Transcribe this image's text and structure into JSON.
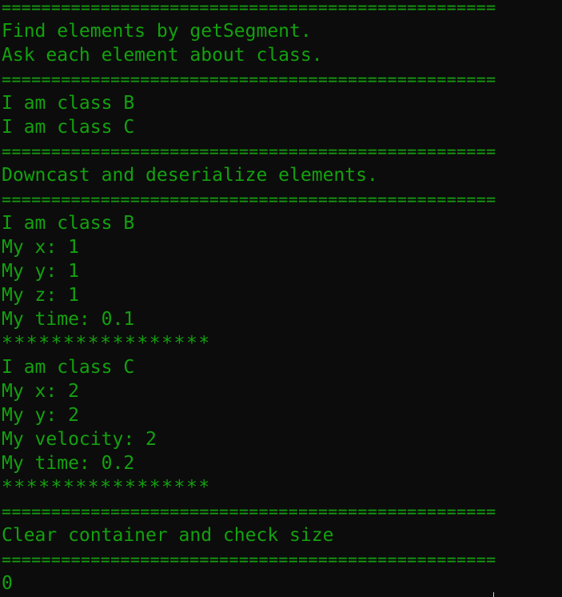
{
  "terminal": {
    "lines": [
      "==================================================",
      "Find elements by getSegment.",
      "Ask each element about class.",
      "==================================================",
      "I am class B",
      "I am class C",
      "==================================================",
      "Downcast and deserialize elements.",
      "==================================================",
      "I am class B",
      "My x: 1",
      "My y: 1",
      "My z: 1",
      "My time: 0.1",
      "*****************",
      "I am class C",
      "My x: 2",
      "My y: 2",
      "My velocity: 2",
      "My time: 0.2",
      "*****************",
      "",
      "==================================================",
      "Clear container and check size",
      "==================================================",
      "0"
    ]
  },
  "colors": {
    "background": "#0c0c0c",
    "text": "#13a10e"
  }
}
